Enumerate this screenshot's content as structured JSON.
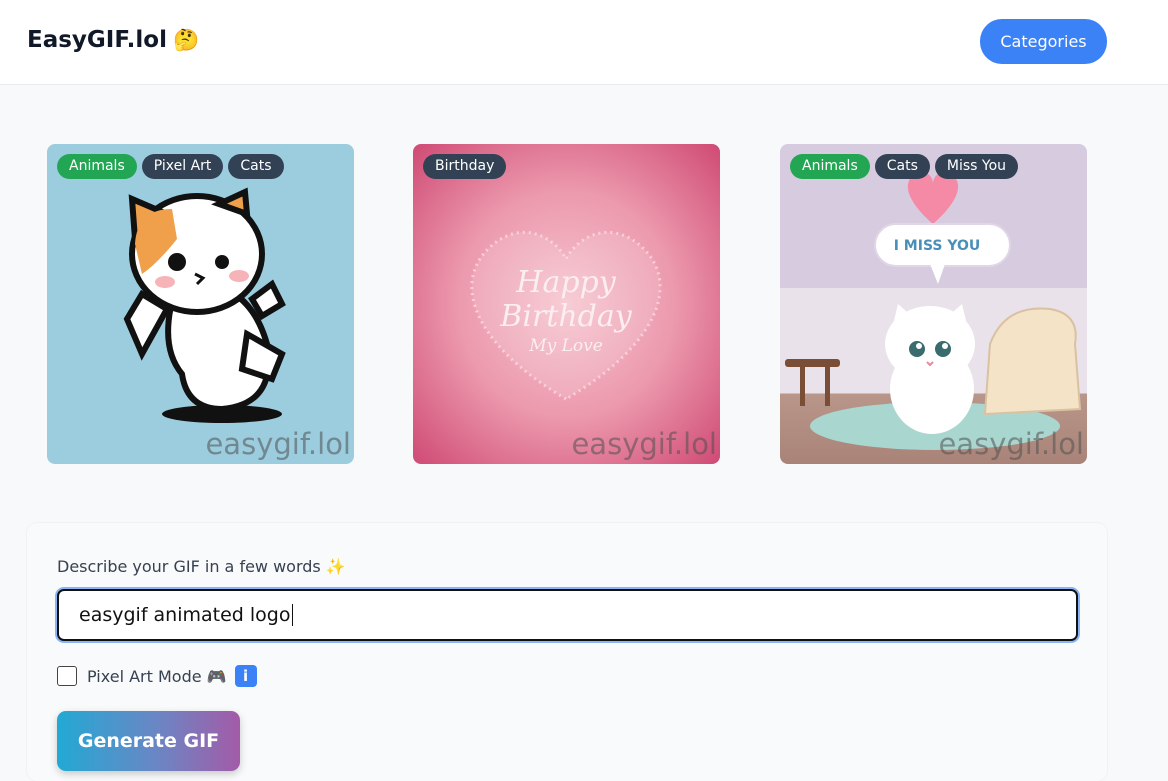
{
  "header": {
    "logo_text": "EasyGIF.lol",
    "logo_emoji": "🤔",
    "categories_label": "Categories"
  },
  "gallery": [
    {
      "tags": [
        "Animals",
        "Pixel Art",
        "Cats"
      ],
      "watermark": "easygif.lol",
      "image": "pixel-art-calico-cat-dancing"
    },
    {
      "tags": [
        "Birthday"
      ],
      "watermark": "easygif.lol",
      "image": "happy-birthday-heart-card",
      "card_text": [
        "Happy",
        "Birthday",
        "My Love"
      ]
    },
    {
      "tags": [
        "Animals",
        "Cats",
        "Miss You"
      ],
      "watermark": "easygif.lol",
      "image": "white-kitten-miss-you-room",
      "card_text": [
        "I MISS YOU"
      ]
    }
  ],
  "form": {
    "label": "Describe your GIF in a few words ✨",
    "input_value": "easygif animated logo",
    "pixel_art_label": "Pixel Art Mode 🎮",
    "pixel_art_checked": false,
    "info_icon": "info-icon",
    "info_glyph": "i",
    "generate_label": "Generate GIF"
  },
  "colors": {
    "primary": "#3b82f6",
    "tag_green": "#22a653",
    "tag_dark": "#334155"
  }
}
